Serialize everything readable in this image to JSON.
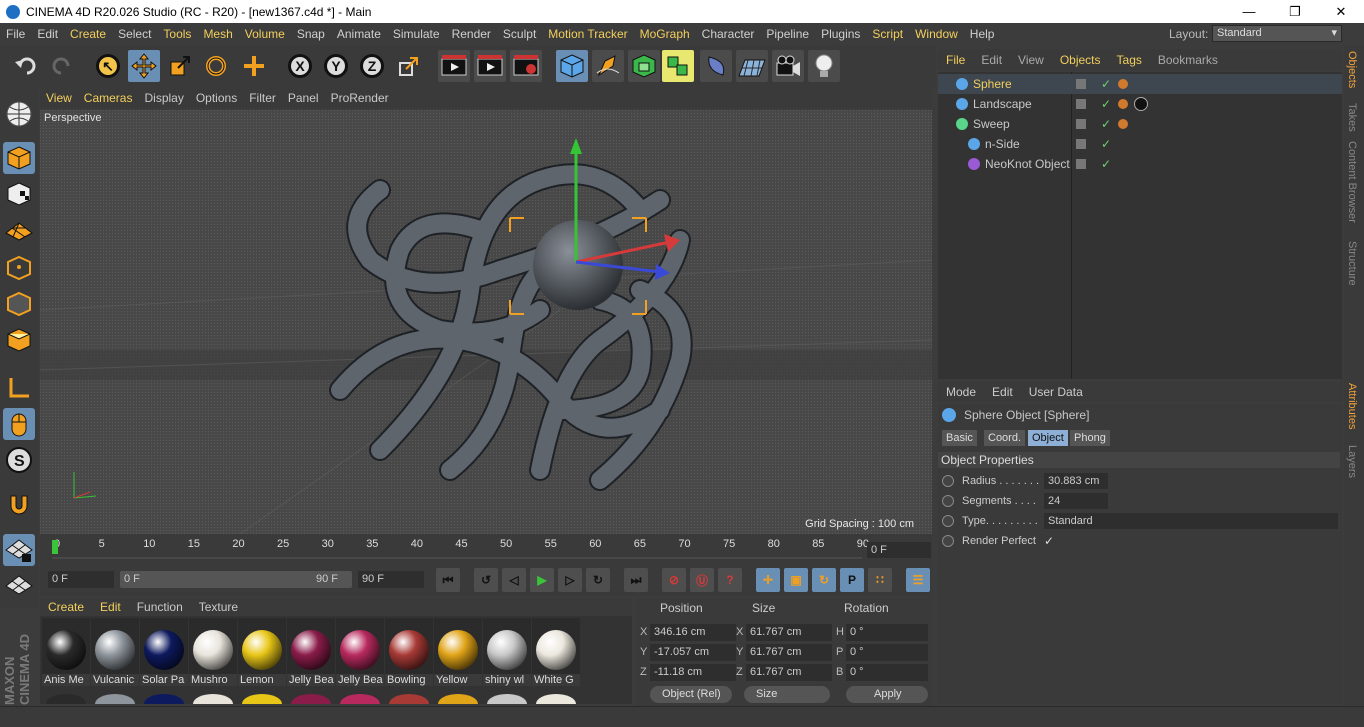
{
  "title_bar": {
    "text": "CINEMA 4D R20.026 Studio (RC - R20) - [new1367.c4d *] - Main",
    "minimize": "—",
    "maximize": "❐",
    "close": "✕"
  },
  "menu": [
    "File",
    "Edit",
    "Create",
    "Select",
    "Tools",
    "Mesh",
    "Volume",
    "Snap",
    "Animate",
    "Simulate",
    "Render",
    "Sculpt",
    "Motion Tracker",
    "MoGraph",
    "Character",
    "Pipeline",
    "Plugins",
    "Script",
    "Window",
    "Help"
  ],
  "menu_highlight": [
    "Create",
    "Tools",
    "Mesh",
    "Volume",
    "Motion Tracker",
    "MoGraph",
    "Script",
    "Window"
  ],
  "layout": {
    "label": "Layout:",
    "value": "Standard"
  },
  "toolbar_axes": [
    "X",
    "Y",
    "Z"
  ],
  "viewport": {
    "menu": [
      "View",
      "Cameras",
      "Display",
      "Options",
      "Filter",
      "Panel",
      "ProRender"
    ],
    "highlight": [
      "View",
      "Cameras"
    ],
    "label": "Perspective",
    "grid_spacing": "Grid Spacing : 100 cm"
  },
  "timeline": {
    "ticks": [
      "0",
      "5",
      "10",
      "15",
      "20",
      "25",
      "30",
      "35",
      "40",
      "45",
      "50",
      "55",
      "60",
      "65",
      "70",
      "75",
      "80",
      "85",
      "90"
    ],
    "frame": "0 F"
  },
  "transport": {
    "start": "0 F",
    "range_start": "0 F",
    "range_end": "90 F",
    "end": "90 F"
  },
  "materials": {
    "menu": [
      "Create",
      "Edit",
      "Function",
      "Texture"
    ],
    "highlight": [
      "Create",
      "Edit"
    ],
    "items": [
      {
        "name": "Anis Me",
        "color": "#2a2a2a"
      },
      {
        "name": "Vulcanic",
        "color": "#8e959c"
      },
      {
        "name": "Solar Pa",
        "color": "#0d1a5e"
      },
      {
        "name": "Mushro",
        "color": "#e8e4dc"
      },
      {
        "name": "Lemon",
        "color": "#e8c618"
      },
      {
        "name": "Jelly Bea",
        "color": "#8a1c4a"
      },
      {
        "name": "Jelly Bea",
        "color": "#b82a5e"
      },
      {
        "name": "Bowling",
        "color": "#a83a36"
      },
      {
        "name": "Yellow",
        "color": "#e0a418"
      },
      {
        "name": "shiny wl",
        "color": "#c8c8c8"
      },
      {
        "name": "White G",
        "color": "#ece8de"
      }
    ]
  },
  "coordinates": {
    "headers": [
      "Position",
      "Size",
      "Rotation"
    ],
    "rows": [
      {
        "axis": "X",
        "pos": "346.16 cm",
        "saxis": "X",
        "size": "61.767 cm",
        "raxis": "H",
        "rot": "0 °"
      },
      {
        "axis": "Y",
        "pos": "-17.057 cm",
        "saxis": "Y",
        "size": "61.767 cm",
        "raxis": "P",
        "rot": "0 °"
      },
      {
        "axis": "Z",
        "pos": "-11.18 cm",
        "saxis": "Z",
        "size": "61.767 cm",
        "raxis": "B",
        "rot": "0 °"
      }
    ],
    "mode": "Object (Rel)",
    "size_mode": "Size",
    "apply": "Apply"
  },
  "objects": {
    "menu": [
      "File",
      "Edit",
      "View",
      "Objects",
      "Tags",
      "Bookmarks"
    ],
    "highlight": [
      "File",
      "Objects",
      "Tags"
    ],
    "items": [
      {
        "name": "Sphere",
        "color": "#f2cf5c",
        "indent": 0
      },
      {
        "name": "Landscape",
        "color": "#c8c8c8",
        "indent": 0
      },
      {
        "name": "Sweep",
        "color": "#c8c8c8",
        "indent": 0
      },
      {
        "name": "n-Side",
        "color": "#c8c8c8",
        "indent": 1
      },
      {
        "name": "NeoKnot Object",
        "color": "#c8c8c8",
        "indent": 1
      }
    ]
  },
  "attributes": {
    "menu": [
      "Mode",
      "Edit",
      "User Data"
    ],
    "object_title": "Sphere Object [Sphere]",
    "tabs": [
      "Basic",
      "Coord.",
      "Object",
      "Phong"
    ],
    "active_tab": "Object",
    "section": "Object Properties",
    "props": [
      {
        "label": "Radius . . . . . . .",
        "value": "30.883 cm"
      },
      {
        "label": "Segments . . . .",
        "value": "24"
      },
      {
        "label": "Type. . . . . . . . .",
        "value": "Standard"
      },
      {
        "label": "Render Perfect",
        "value": "✓"
      }
    ]
  },
  "right_tabs": [
    "Objects",
    "Takes",
    "Content Browser",
    "Structure",
    "Attributes",
    "Layers"
  ],
  "brand": "MAXON CINEMA 4D"
}
